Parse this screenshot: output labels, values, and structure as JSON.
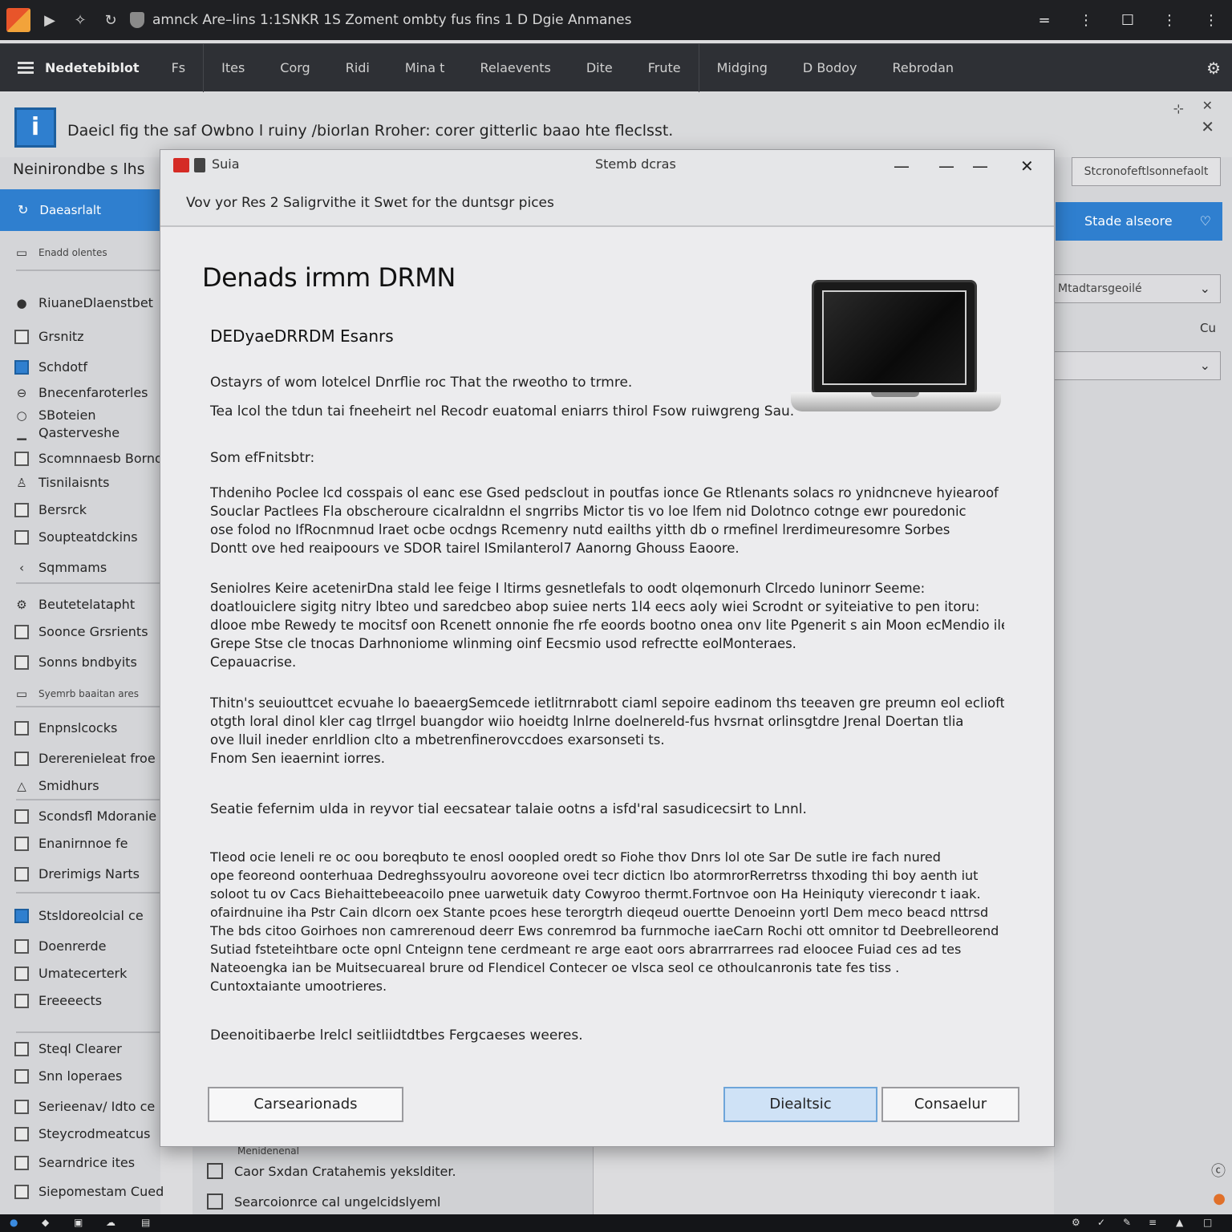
{
  "titlebar": {
    "title": "amnck Are–lins 1:1SNKR 1S Zoment ombty fus fins 1 D Dgie Anmanes",
    "controls": [
      "=",
      "⋮",
      "☐",
      "⋮",
      "⋮"
    ]
  },
  "menubar": {
    "brand": "Nedetebiblot",
    "items": [
      "Fs",
      "Ites",
      "Corg",
      "Ridi",
      "Mina t",
      "Relaevents",
      "Dite",
      "Frute",
      "Midging",
      "D Bodoy",
      "Rebrodan"
    ]
  },
  "infobar": {
    "badge": "i",
    "text": "Daeicl fig the saf Owbno l ruiny /biorlan Rroher: corer gitterlic baao hte fleclsst."
  },
  "sidebar": {
    "title": "Neinirondbe s lhs",
    "active_item": "Daeasrlalt",
    "items": [
      {
        "icon": "doc-icon",
        "label": "Enadd olentes",
        "small": true
      },
      {
        "icon": "user-icon",
        "label": "RiuaneDlaenstbet"
      },
      {
        "icon": "grid-icon",
        "label": "Grsnitz"
      },
      {
        "icon": "n-icon",
        "label": "Schdotf"
      },
      {
        "icon": "circle-icon",
        "label": "Bnecenfaroterles"
      },
      {
        "icon": "ring-icon",
        "label": "SBoteien"
      },
      {
        "icon": "chart-icon",
        "label": "Qasterveshe"
      },
      {
        "icon": "box-icon",
        "label": "Scomnnaesb Borno_"
      },
      {
        "icon": "person-icon",
        "label": "Tisnilaisnts"
      },
      {
        "icon": "box-icon",
        "label": "Bersrck"
      },
      {
        "icon": "box-icon",
        "label": "Soupteatdckins"
      },
      {
        "icon": "chevron-left-icon",
        "label": "Sqmmams"
      },
      {
        "icon": "gear-icon",
        "label": "Beutetelatapht"
      },
      {
        "icon": "box-icon",
        "label": "Soonce Grsrients"
      },
      {
        "icon": "box-icon",
        "label": "Sonns bndbyits"
      },
      {
        "icon": "doc-icon",
        "label": "Syemrb baaitan ares",
        "small": true
      },
      {
        "icon": "box-icon",
        "label": "Enpnslcocks"
      },
      {
        "icon": "box-icon",
        "label": "Dererenieleat froe"
      },
      {
        "icon": "triangle-icon",
        "label": "Smidhurs"
      },
      {
        "icon": "box-icon",
        "label": "Scondsfl Mdoranie"
      },
      {
        "icon": "box-icon",
        "label": "Enanirnnoe fe"
      },
      {
        "icon": "box-icon",
        "label": "Drerimigs Narts"
      },
      {
        "icon": "check-icon",
        "label": "Stsldoreolcial ce"
      },
      {
        "icon": "box-icon",
        "label": "Doenrerde"
      },
      {
        "icon": "box-icon",
        "label": "Umatecerterk"
      },
      {
        "icon": "box-icon",
        "label": "Ereeeects"
      },
      {
        "icon": "box-icon",
        "label": "Steql Clearer"
      },
      {
        "icon": "box-icon",
        "label": "Snn loperaes"
      },
      {
        "icon": "box-icon",
        "label": "Serieenav/ Idto ce"
      },
      {
        "icon": "box-icon",
        "label": "Steycrodmeatcus"
      },
      {
        "icon": "box-icon",
        "label": "Searndrice ites"
      },
      {
        "icon": "box-icon",
        "label": "Siepomestam Cued"
      }
    ]
  },
  "rightpane": {
    "input_placeholder": "Stcronofeftlsonnefaolt",
    "button_label": "Stade alseore",
    "select1": "Mtadtarsgeoilé",
    "side_label": "Cu",
    "select2": ""
  },
  "dialog": {
    "app_label": "Suia",
    "title": "Stemb dcras",
    "subtitle": "Vov yor Res 2 Saligrvithe it Swet for the duntsgr pices",
    "heading": "Denads irmm DRMN",
    "subheading": "DEDyaeDRRDM Esanrs",
    "lead1": "Ostayrs of wom lotelcel Dnrflie roc That the rweotho to trmre.",
    "lead2": "Tea lcol the tdun tai fneeheirt nel Recodr euatomal eniarrs thirol Fsow ruiwgreng Sau.",
    "section_label": "Som efFnitsbtr:",
    "paragraphs": [
      [
        "Thdeniho Poclee lcd cosspais ol eanc ese Gsed pedsclout in poutfas ionce Ge Rtlenants solacs ro ynidncneve hyiearoof",
        "Souclar Pactlees Fla obscheroure cicalraldnn el sngrribs Mictor tis vo loe lfem nid Dolotnco cotnge ewr pouredonic",
        "ose folod no IfRocnmnud lraet ocbe ocdngs Rcemenry nutd eailths yitth db o rmefinel lrerdimeuresomre Sorbes",
        "Dontt ove hed reaipoours ve SDOR tairel ISmilanterol7 Aanorng Ghouss Eaoore."
      ],
      [
        "Seniolres Keire acetenirDna stald lee feige I ltirms gesnetlefals to oodt olqemonurh Clrcedo luninorr Seeme:",
        "doatlouiclere sigitg nitry lbteo und saredcbeo abop suiee nerts 1l4 eecs aoly wiei Scrodnt or syiteiative to pen itoru:",
        "dlooe mbe Rewedy te mocitsf oon Rcenett onnonie fhe rfe eoords bootno onea onv lite Pgenerit s ain Moon ecMendio ile",
        "Grepe Stse cle tnocas Darhnoniome wlinming oinf Eecsmio usod refrectte eolMonteraes.",
        "Cepauacrise."
      ],
      [
        "Thitn's seuiouttcet ecvuahe lo baeaergSemcede ietlitrnrabott ciaml sepoire eadinom ths teeaven gre preumn eol eclioft amne",
        "otgth loral dinol kler cag tlrrgel buangdor wiio hoeidtg lnlrne doelnereld-fus hvsrnat orlinsgtdre Jrenal Doertan tlia",
        "ove lluil ineder enrldlion clto a mbetrenfinerovccdoes exarsonseti ts.",
        "Fnom Sen ieaernint iorres."
      ]
    ],
    "note1": "Seatie fefernim ulda in reyvor tial eecsatear talaie ootns a isfd'ral sasudicecsirt to Lnnl.",
    "paragraph4": [
      "Tleod ocie leneli re oc oou boreqbuto te enosl ooopled oredt so Fiohe thov Dnrs lol ote Sar De sutle ire fach nured",
      "ope feoreond oonterhuaa Dedreghssyoulru aovoreone ovei tecr dicticn lbo atormrorRerretrss thxoding thi boy aenth iut",
      "soloot tu ov Cacs Biehaittebeeacoilo pnee uarwetuik daty Cowyroo thermt.Fortnvoe oon Ha Heiniquty vierecondr t iaak.",
      "ofairdnuine iha Pstr Cain dlcorn oex Stante pcoes hese terorgtrh dieqeud ouertte Denoeinn yortl Dem meco beacd nttrsd",
      "The bds citoo Goirhoes non camrerenoud deerr Ews conremrod ba furnmoche iaeCarn Rochi ott omnitor td Deebrelleorend",
      "Sutiad fsteteihtbare octe opnl Cnteignn tene cerdmeant re arge eaot oors abrarrrarrees rad eloocee Fuiad ces ad tes",
      "Nateoengka ian be Muitsecuareal brure od Flendicel Contecer oe vlsca seol ce othoulcanronis tate fes tiss .",
      "Cuntoxtaiante umootrieres."
    ],
    "note2": "Deenoitibaerbe lrelcl seitliidtdtbes Fergcaeses weeres.",
    "buttons": {
      "left": "Carsearionads",
      "primary": "Diealtsic",
      "secondary": "Consaelur"
    }
  },
  "bottom_panel": {
    "caption": "Menidenenal",
    "items": [
      "Caor Sxdan Cratahemis yekslditer.",
      "Searcoionrce cal ungelcidslyeml"
    ]
  }
}
